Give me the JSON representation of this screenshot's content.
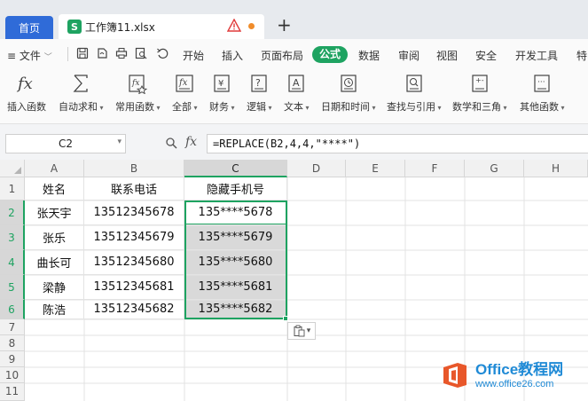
{
  "tabs": {
    "home_label": "首页",
    "file_badge": "S",
    "file_name": "工作簿11.xlsx",
    "new_tab": "+"
  },
  "menu": {
    "file_label": "≡ 文件",
    "items": [
      "开始",
      "插入",
      "页面布局",
      "公式",
      "数据",
      "审阅",
      "视图",
      "安全",
      "开发工具",
      "特"
    ],
    "active": "公式"
  },
  "ribbon": {
    "buttons": [
      {
        "label": "插入函数",
        "icon": "fx-icon",
        "caret": false
      },
      {
        "label": "自动求和",
        "icon": "sigma-icon",
        "caret": true
      },
      {
        "label": "常用函数",
        "icon": "star-function-icon",
        "caret": true
      },
      {
        "label": "全部",
        "icon": "function-library-icon",
        "caret": true
      },
      {
        "label": "财务",
        "icon": "yen-icon",
        "caret": true
      },
      {
        "label": "逻辑",
        "icon": "logic-question-icon",
        "caret": true
      },
      {
        "label": "文本",
        "icon": "text-a-icon",
        "caret": true
      },
      {
        "label": "日期和时间",
        "icon": "clock-icon",
        "caret": true
      },
      {
        "label": "查找与引用",
        "icon": "lookup-icon",
        "caret": true
      },
      {
        "label": "数学和三角",
        "icon": "math-icon",
        "caret": true
      },
      {
        "label": "其他函数",
        "icon": "more-functions-icon",
        "caret": true
      }
    ]
  },
  "formula_bar": {
    "name_box": "C2",
    "fx": "fx",
    "formula": "=REPLACE(B2,4,4,\"****\")"
  },
  "sheet": {
    "columns": [
      "A",
      "B",
      "C",
      "D",
      "E",
      "F",
      "G",
      "H"
    ],
    "selected_column": "C",
    "row_numbers": [
      "1",
      "2",
      "3",
      "4",
      "5",
      "6",
      "7",
      "8",
      "9",
      "10",
      "11"
    ],
    "selected_rows": [
      "2",
      "3",
      "4",
      "5",
      "6"
    ],
    "header_row": [
      "姓名",
      "联系电话",
      "隐藏手机号"
    ],
    "rows": [
      [
        "张天宇",
        "13512345678",
        "135****5678"
      ],
      [
        "张乐",
        "13512345679",
        "135****5679"
      ],
      [
        "曲长可",
        "13512345680",
        "135****5680"
      ],
      [
        "梁静",
        "13512345681",
        "135****5681"
      ],
      [
        "陈浩",
        "13512345682",
        "135****5682"
      ]
    ]
  },
  "paste_options_caret": "▾",
  "watermark": {
    "title": "Office教程网",
    "url": "www.office26.com"
  },
  "colors": {
    "accent": "#1ea361",
    "home_tab": "#2f6bd8",
    "watermark": "#1f8ad6"
  }
}
